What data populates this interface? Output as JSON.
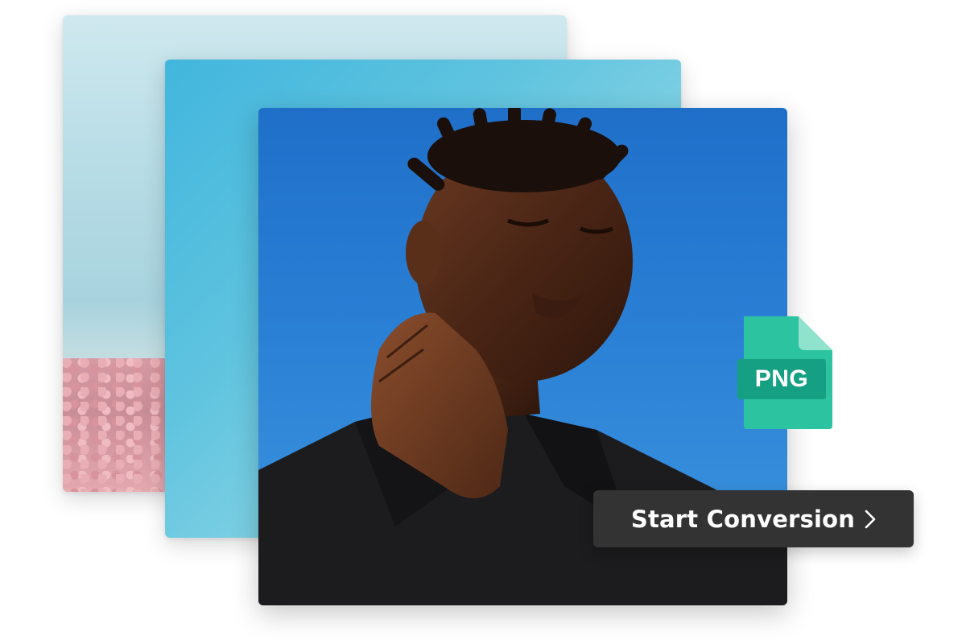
{
  "images": {
    "back": {
      "description_icon": "pink-flower-field-photo"
    },
    "middle": {
      "description_icon": "blue-sky-photo"
    },
    "front": {
      "description_icon": "portrait-photo"
    }
  },
  "badge": {
    "format_label": "PNG",
    "icon": "file-icon",
    "color": "#2cc4a0"
  },
  "action": {
    "start_label": "Start Conversion",
    "icon": "chevron-right-icon",
    "color": "#333333"
  }
}
